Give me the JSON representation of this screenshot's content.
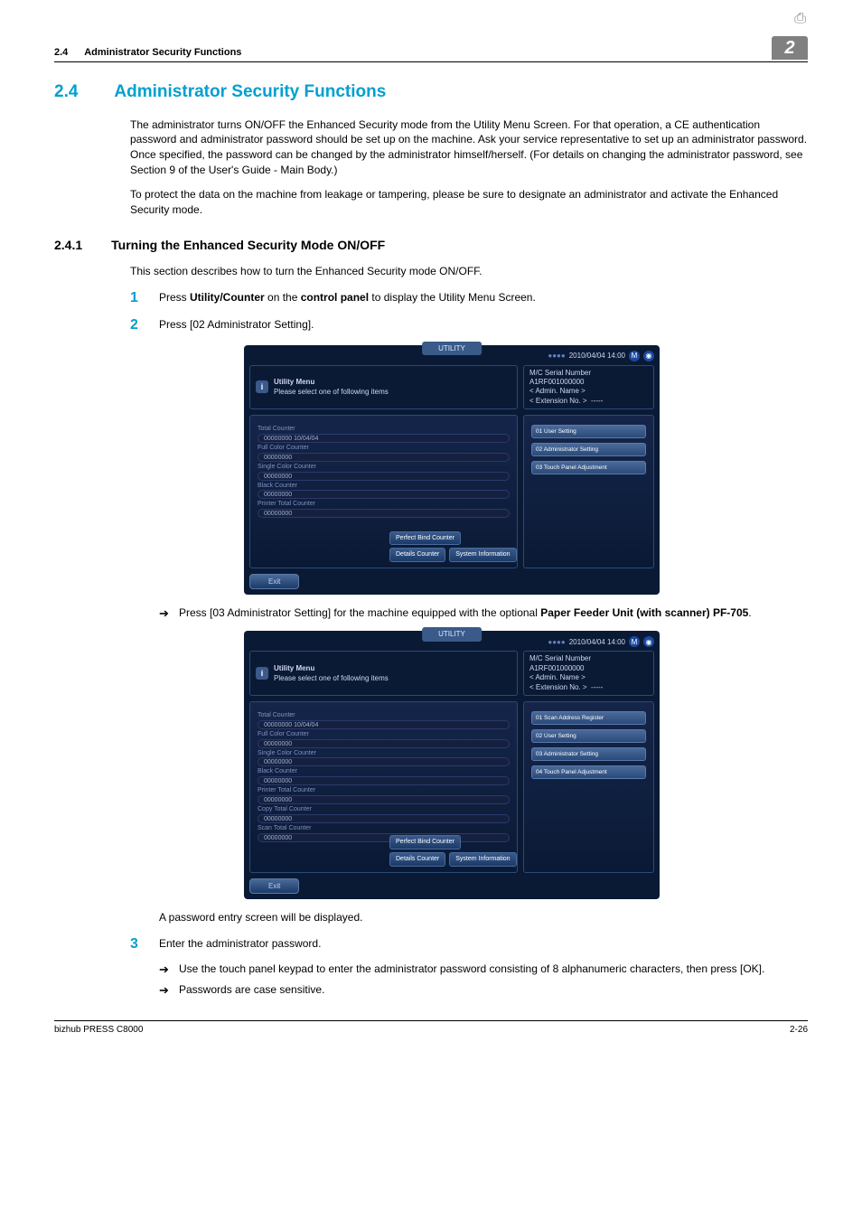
{
  "page": {
    "header_section_num": "2.4",
    "header_section_title": "Administrator Security Functions",
    "chapter_num": "2",
    "footer_left": "bizhub PRESS C8000",
    "footer_right": "2-26"
  },
  "section": {
    "num": "2.4",
    "title": "Administrator Security Functions",
    "para1": "The administrator turns ON/OFF the Enhanced Security mode from the Utility Menu Screen. For that operation, a CE authentication password and administrator password should be set up on the machine. Ask your service representative to set up an administrator password. Once specified, the password can be changed by the administrator himself/herself. (For details on changing the administrator password, see Section 9 of the User's Guide - Main Body.)",
    "para2": "To protect the data on the machine from leakage or tampering, please be sure to designate an administrator and activate the Enhanced Security mode."
  },
  "subsection": {
    "num": "2.4.1",
    "title": "Turning the Enhanced Security Mode ON/OFF",
    "intro": "This section describes how to turn the Enhanced Security mode ON/OFF."
  },
  "steps": {
    "s1": {
      "num": "1",
      "pre": "Press ",
      "b1": "Utility/Counter",
      "mid": " on the ",
      "b2": "control panel",
      "post": " to display the Utility Menu Screen."
    },
    "s2": {
      "num": "2",
      "text": "Press [02 Administrator Setting]."
    },
    "s2_note_pre": "Press [03 Administrator Setting] for the machine equipped with the optional ",
    "s2_note_bold": "Paper Feeder Unit (with scanner) PF-705",
    "s2_note_post": ".",
    "s2_after": "A password entry screen will be displayed.",
    "s3": {
      "num": "3",
      "text": "Enter the administrator password."
    },
    "s3_b1": "Use the touch panel keypad to enter the administrator password consisting of 8 alphanumeric characters, then press [OK].",
    "s3_b2": "Passwords are case sensitive."
  },
  "panel": {
    "tab": "UTILITY",
    "time": "2010/04/04  14:00",
    "menu_title": "Utility Menu",
    "menu_subtitle": "Please select one of following items",
    "info_serial_label": "M/C Serial Number",
    "info_serial_value": "A1RF001000000",
    "info_admin": "< Admin. Name >",
    "info_ext_label": "< Extension No. >",
    "info_ext_value": "-----",
    "counters": {
      "total": "Total Counter",
      "total_v": "00000000    10/04/04",
      "full": "Full Color Counter",
      "full_v": "00000000",
      "single": "Single Color Counter",
      "single_v": "00000000",
      "black": "Black Counter",
      "black_v": "00000000",
      "printer": "Printer Total Counter",
      "printer_v": "00000000",
      "copy": "Copy Total Counter",
      "copy_v": "00000000",
      "scan": "Scan Total Counter",
      "scan_v": "00000000"
    },
    "btn_perfect": "Perfect Bind Counter",
    "btn_details": "Details Counter",
    "btn_sysinfo": "System Information",
    "btn_exit": "Exit",
    "right1": {
      "b1": "01 User Setting",
      "b2": "02 Administrator Setting",
      "b3": "03 Touch Panel Adjustment"
    },
    "right2": {
      "b1": "01 Scan Address Register",
      "b2": "02 User Setting",
      "b3": "03 Administrator Setting",
      "b4": "04 Touch Panel Adjustment"
    }
  }
}
